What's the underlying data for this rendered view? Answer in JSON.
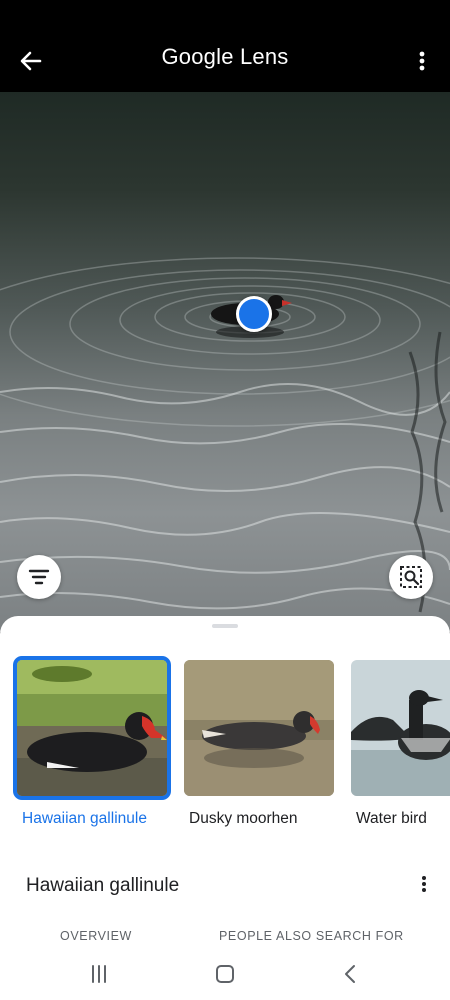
{
  "header": {
    "title_google": "Google",
    "title_lens": "Lens"
  },
  "icons": {
    "back": "arrow-left-icon",
    "more": "more-vert-icon",
    "filter": "filter-list-icon",
    "lens_search": "image-search-icon",
    "selection_dot": "selection-dot"
  },
  "results": {
    "cards": [
      {
        "label": "Hawaiian gallinule",
        "selected": true
      },
      {
        "label": "Dusky moorhen",
        "selected": false
      },
      {
        "label": "Water bird",
        "selected": false
      }
    ],
    "detail_title": "Hawaiian gallinule",
    "tabs": [
      "OVERVIEW",
      "PEOPLE ALSO SEARCH FOR"
    ]
  },
  "navbar": {
    "items": [
      "recent-apps-icon",
      "home-icon",
      "back-icon"
    ]
  },
  "colors": {
    "accent": "#1a73e8",
    "text": "#202124",
    "secondary": "#5f6368"
  }
}
